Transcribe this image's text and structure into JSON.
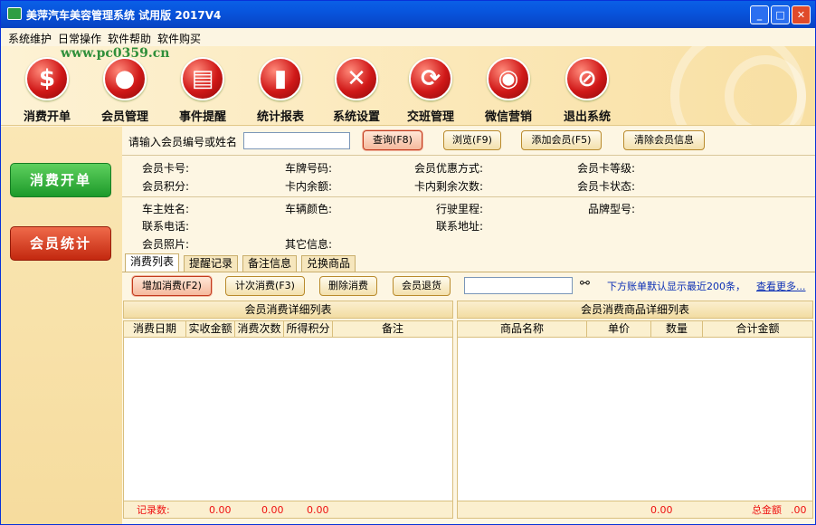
{
  "window": {
    "title": "美萍汽车美容管理系统 试用版  2017V4",
    "btn_min": "_",
    "btn_max": "□",
    "btn_close": "✕"
  },
  "menu": [
    "系统维护",
    "日常操作",
    "软件帮助",
    "软件购买"
  ],
  "watermark": "www.pc0359.cn",
  "toolbar": [
    {
      "label": "消费开单",
      "icon": "dollar-icon",
      "glyph": "$"
    },
    {
      "label": "会员管理",
      "icon": "person-icon",
      "glyph": "●"
    },
    {
      "label": "事件提醒",
      "icon": "book-icon",
      "glyph": "▤"
    },
    {
      "label": "统计报表",
      "icon": "bar-chart-icon",
      "glyph": "▮"
    },
    {
      "label": "系统设置",
      "icon": "tools-icon",
      "glyph": "✕"
    },
    {
      "label": "交班管理",
      "icon": "refresh-icon",
      "glyph": "⟳"
    },
    {
      "label": "微信营销",
      "icon": "wechat-icon",
      "glyph": "◉"
    },
    {
      "label": "退出系统",
      "icon": "exit-icon",
      "glyph": "⊘"
    }
  ],
  "side": {
    "sale_label": "消费开单",
    "stats_label": "会员统计"
  },
  "search": {
    "prompt": "请输入会员编号或姓名",
    "value": "",
    "query": "查询(F8)",
    "browse": "浏览(F9)",
    "add_member": "添加会员(F5)",
    "clear_info": "清除会员信息"
  },
  "member_info": {
    "card_no": "会员卡号:",
    "plate": "车牌号码:",
    "discount": "会员优惠方式:",
    "level": "会员卡等级:",
    "points": "会员积分:",
    "balance": "卡内余额:",
    "remain": "卡内剩余次数:",
    "status": "会员卡状态:",
    "owner": "车主姓名:",
    "color": "车辆颜色:",
    "mileage": "行驶里程:",
    "model": "品牌型号:",
    "phone": "联系电话:",
    "address": "联系地址:",
    "photo": "会员照片:",
    "other": "其它信息:"
  },
  "tabs": [
    "消费列表",
    "提醒记录",
    "备注信息",
    "兑换商品"
  ],
  "actions": {
    "add": "增加消费(F2)",
    "times": "计次消费(F3)",
    "delete": "删除消费",
    "refund": "会员退货",
    "filter_value": "",
    "hint": "下方账单默认显示最近200条，",
    "more": "查看更多..."
  },
  "left_table": {
    "title": "会员消费详细列表",
    "columns": [
      "消费日期",
      "实收金额",
      "消费次数",
      "所得积分",
      "备注"
    ],
    "record_label": "记录数:",
    "totals": [
      "0.00",
      "0.00",
      "0.00"
    ]
  },
  "right_table": {
    "title": "会员消费商品详细列表",
    "columns": [
      "商品名称",
      "单价",
      "数量",
      "合计金额"
    ],
    "total_value": "0.00",
    "total_label": "总金额",
    "total_amount": ".00"
  },
  "colors": {
    "accent": "#0a5fe6",
    "button_red": "#d01818",
    "side_green": "#1d9a2a",
    "footer_red": "#e11111"
  }
}
